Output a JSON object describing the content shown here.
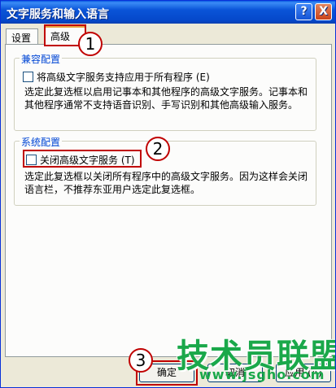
{
  "window": {
    "title": "文字服务和输入语言",
    "help_glyph": "?",
    "close_glyph": "X"
  },
  "tabs": [
    {
      "label": "设置",
      "active": false
    },
    {
      "label": "高级",
      "active": true
    }
  ],
  "compat_group": {
    "legend": "兼容配置",
    "checkbox_label": "将高级文字服务支持应用于所有程序 (E)",
    "checked": false,
    "description": "选定此复选框以启用记事本和其他程序的高级文字服务。记事本和其他程序通常不支持语音识别、手写识别和其他高级输入服务。"
  },
  "system_group": {
    "legend": "系统配置",
    "checkbox_label": "关闭高级文字服务 (T)",
    "checked": false,
    "description": "选定此复选框以关闭所有程序中的高级文字服务。因为这样会关闭语言栏，不推荐东亚用户选定此复选框。"
  },
  "buttons": {
    "ok": "确定",
    "cancel": "取消",
    "apply": "应用 (A)"
  },
  "annotations": {
    "step1": "1",
    "step2": "2",
    "step3": "3"
  },
  "watermark": {
    "main": "技术员联盟",
    "sub": "www.jsgho.com"
  },
  "colors": {
    "title_bar": "#0a54d8",
    "highlight": "#c00000",
    "legend": "#0046d5",
    "watermark": "#1aa84a"
  }
}
